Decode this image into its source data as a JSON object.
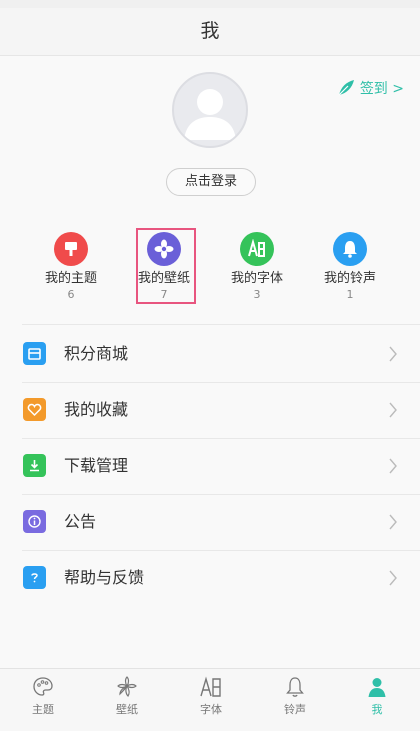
{
  "header": {
    "title": "我"
  },
  "profile": {
    "signin_label": "签到 >",
    "login_label": "点击登录"
  },
  "quick": [
    {
      "label": "我的主题",
      "count": "6",
      "color": "#f04b4b",
      "icon": "theme-icon"
    },
    {
      "label": "我的壁纸",
      "count": "7",
      "color": "#6a5fd8",
      "icon": "wallpaper-flower-icon"
    },
    {
      "label": "我的字体",
      "count": "3",
      "color": "#35c35a",
      "icon": "font-icon"
    },
    {
      "label": "我的铃声",
      "count": "1",
      "color": "#2a9ff1",
      "icon": "bell-icon"
    }
  ],
  "menu": [
    {
      "label": "积分商城",
      "color": "#2a9ff1",
      "icon": "store-icon"
    },
    {
      "label": "我的收藏",
      "color": "#f39a2b",
      "icon": "heart-icon"
    },
    {
      "label": "下载管理",
      "color": "#35c35a",
      "icon": "download-icon"
    },
    {
      "label": "公告",
      "color": "#7a6be0",
      "icon": "info-icon"
    },
    {
      "label": "帮助与反馈",
      "color": "#2a9ff1",
      "icon": "help-icon"
    }
  ],
  "tabs": [
    {
      "label": "主题",
      "icon": "palette-icon"
    },
    {
      "label": "壁纸",
      "icon": "flower-icon"
    },
    {
      "label": "字体",
      "icon": "font-icon"
    },
    {
      "label": "铃声",
      "icon": "bell-icon"
    },
    {
      "label": "我",
      "icon": "person-icon",
      "active": true
    }
  ],
  "accent": "#2fbfa8",
  "highlight_color": "#e8557f"
}
